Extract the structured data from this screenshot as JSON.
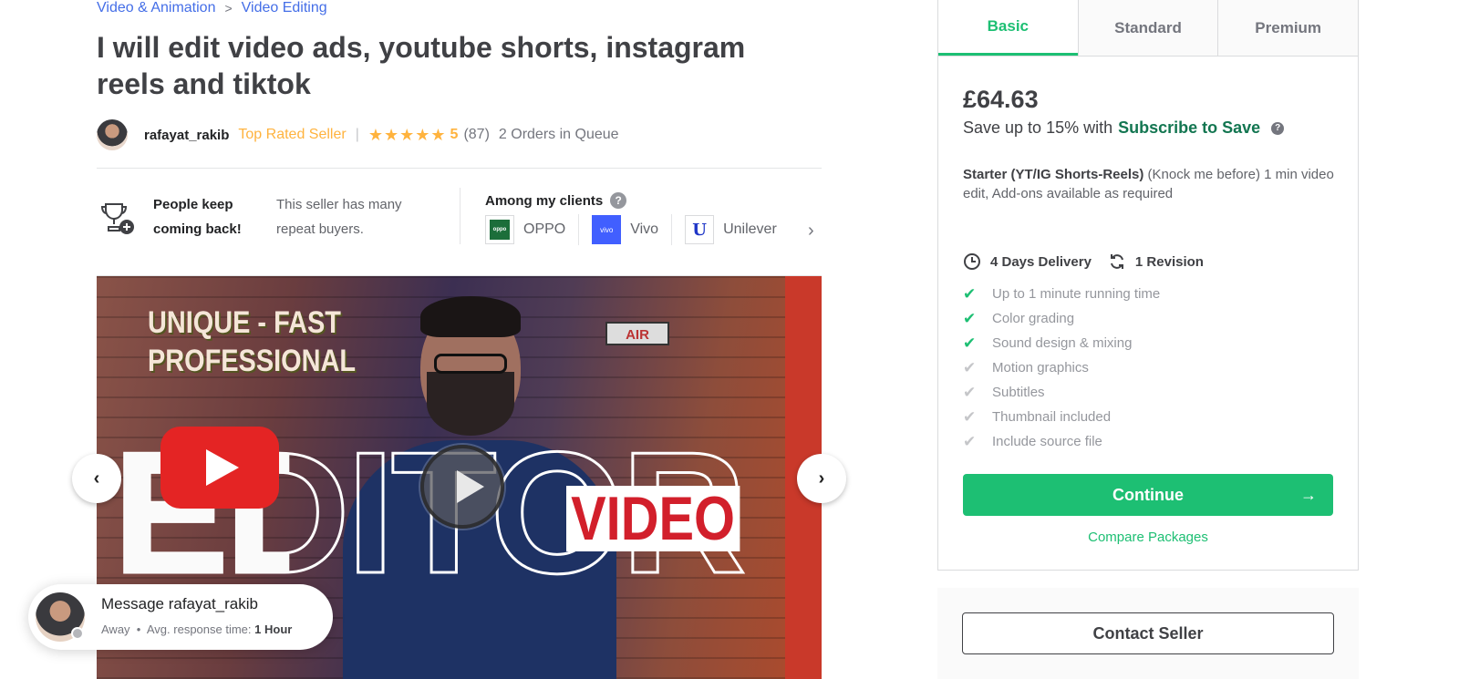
{
  "breadcrumb": {
    "category": "Video & Animation",
    "subcategory": "Video Editing",
    "separator": ">"
  },
  "gig": {
    "title": "I will edit video ads, youtube shorts, instagram reels and tiktok"
  },
  "seller": {
    "name": "rafayat_rakib",
    "level": "Top Rated Seller",
    "divider": "|",
    "stars": "★★★★★",
    "rating": "5",
    "reviews": "(87)",
    "queue": "2 Orders in Queue"
  },
  "highlights": {
    "keep_title": "People keep coming back!",
    "keep_desc": "This seller has many repeat buyers.",
    "clients_title": "Among my clients",
    "help": "?",
    "clients": [
      {
        "name": "OPPO",
        "logo": "oppo"
      },
      {
        "name": "Vivo",
        "logo": "vivo"
      },
      {
        "name": "Unilever",
        "logo": "U"
      }
    ],
    "more": "›"
  },
  "gallery": {
    "text_top": "UNIQUE - FAST\nPROFESSIONAL",
    "text_big": "EDITOR",
    "text_video": "VIDEO",
    "text_air": "AIR",
    "prev": "‹",
    "next": "›"
  },
  "message": {
    "title": "Message rafayat_rakib",
    "status": "Away",
    "bullet": "•",
    "response_label": "Avg. response time:",
    "response_value": "1 Hour"
  },
  "package": {
    "tabs": [
      "Basic",
      "Standard",
      "Premium"
    ],
    "active_tab": "Basic",
    "price": "£64.63",
    "save_text": "Save up to 15% with",
    "save_link": "Subscribe to Save",
    "help": "?",
    "name": "Starter (YT/IG Shorts-Reels)",
    "description": " (Knock me before)  1 min video edit, Add-ons available as required",
    "delivery": "4 Days Delivery",
    "revisions": "1 Revision",
    "features": [
      {
        "label": "Up to 1 minute running time",
        "included": true
      },
      {
        "label": "Color grading",
        "included": true
      },
      {
        "label": "Sound design & mixing",
        "included": true
      },
      {
        "label": "Motion graphics",
        "included": false
      },
      {
        "label": "Subtitles",
        "included": false
      },
      {
        "label": "Thumbnail included",
        "included": false
      },
      {
        "label": "Include source file",
        "included": false
      }
    ],
    "continue_label": "Continue",
    "continue_arrow": "→",
    "compare_label": "Compare Packages",
    "contact_label": "Contact Seller"
  },
  "colors": {
    "brand_green": "#1dbf73",
    "link_blue": "#446ee7",
    "star": "#ffb33e",
    "text": "#404145"
  }
}
